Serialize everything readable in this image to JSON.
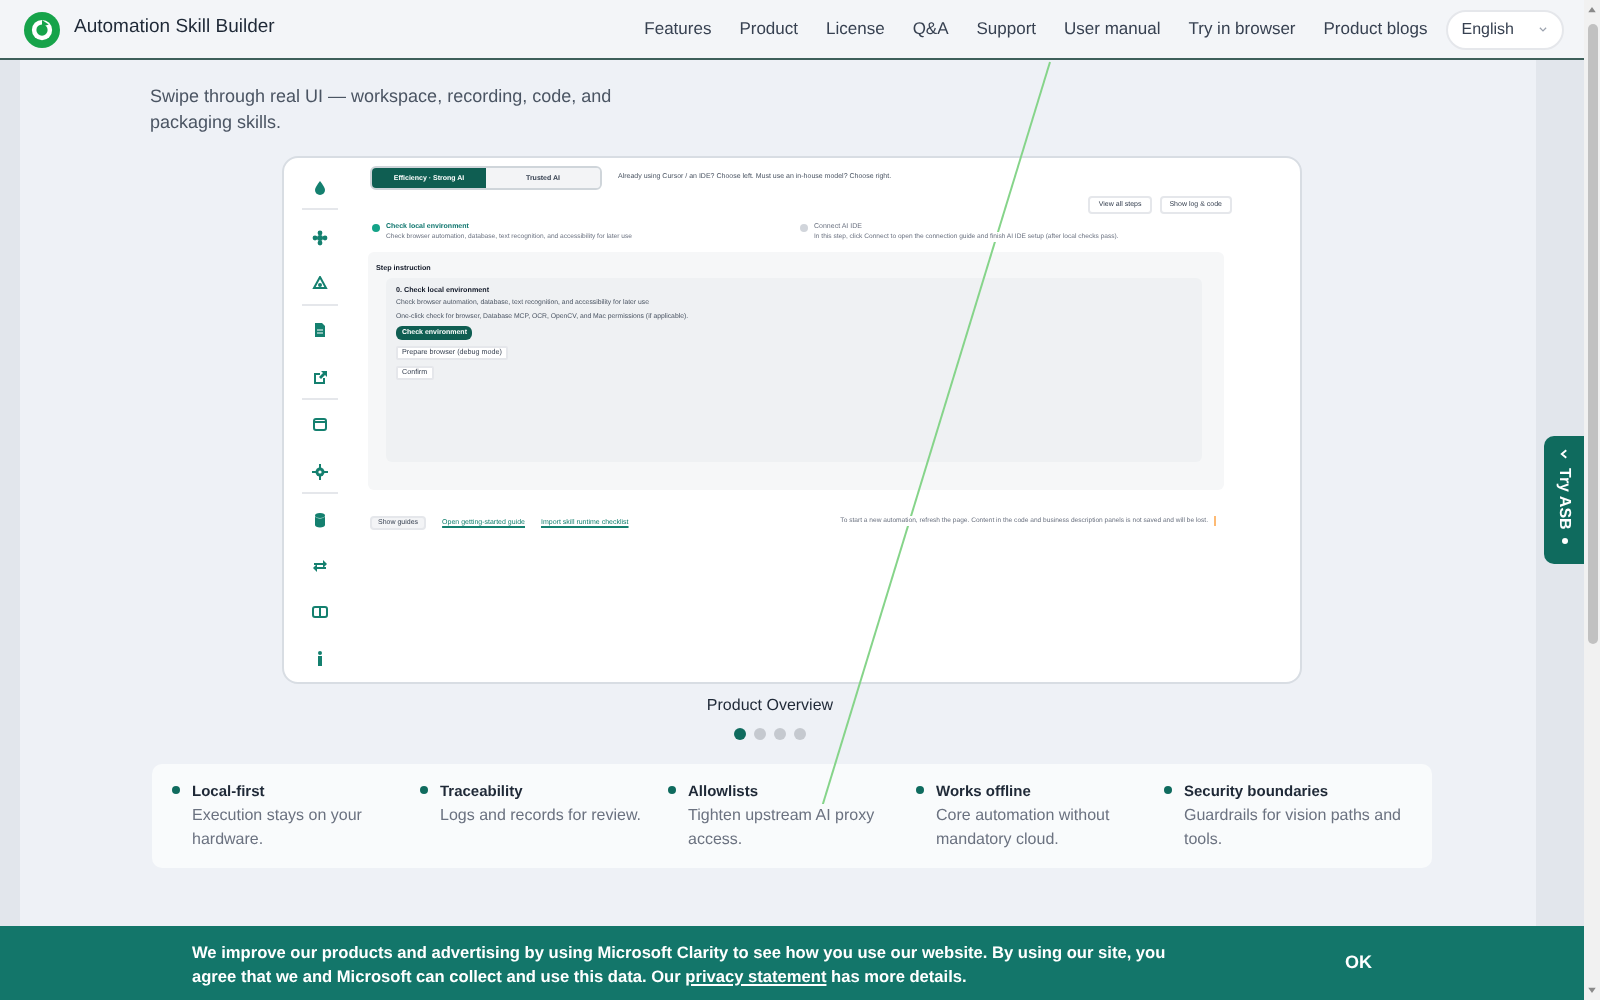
{
  "header": {
    "brand": "Automation Skill Builder",
    "nav": [
      "Features",
      "Product",
      "License",
      "Q&A",
      "Support",
      "User manual",
      "Try in browser",
      "Product blogs"
    ],
    "language": "English"
  },
  "hero": {
    "subtitle": "Swipe through real UI — workspace, recording, code, and packaging skills."
  },
  "preview": {
    "mode_tabs": [
      {
        "label": "Efficiency · Strong AI",
        "selected": true
      },
      {
        "label": "Trusted AI",
        "selected": false
      }
    ],
    "mode_hint": "Already using Cursor / an IDE? Choose left. Must use an in-house model? Choose right.",
    "actions": [
      "View all steps",
      "Show log & code"
    ],
    "steps": [
      {
        "title": "Check local environment",
        "desc": "Check browser automation, database, text recognition, and accessibility for later use",
        "active": true
      },
      {
        "title": "Connect AI IDE",
        "desc": "In this step, click Connect to open the connection guide and finish AI IDE setup (after local checks pass).",
        "active": false
      }
    ],
    "instruction": {
      "heading": "Step instruction",
      "title": "0. Check local environment",
      "lines": [
        "Check browser automation, database, text recognition, and accessibility for later use",
        "One-click check for browser, Database MCP, OCR, OpenCV, and Mac permissions (if applicable)."
      ],
      "primary": "Check environment",
      "secondary": [
        "Prepare browser (debug mode)",
        "Confirm"
      ]
    },
    "footer": {
      "button": "Show guides",
      "links": [
        "Open getting-started guide",
        "Import skill runtime checklist"
      ],
      "note": "To start a new automation, refresh the page. Content in the code and business description panels is not saved and will be lost."
    }
  },
  "carousel": {
    "caption": "Product Overview",
    "dots": [
      {
        "selected": true
      },
      {
        "selected": false
      },
      {
        "selected": false
      },
      {
        "selected": false
      }
    ]
  },
  "features": [
    {
      "title": "Local-first",
      "desc": "Execution stays on your hardware."
    },
    {
      "title": "Traceability",
      "desc": "Logs and records for review."
    },
    {
      "title": "Allowlists",
      "desc": "Tighten upstream AI proxy access."
    },
    {
      "title": "Works offline",
      "desc": "Core automation without mandatory cloud."
    },
    {
      "title": "Security boundaries",
      "desc": "Guardrails for vision paths and tools."
    }
  ],
  "try_tab": {
    "label": "Try ASB"
  },
  "cookie": {
    "text_before": "We improve our products and advertising by using Microsoft Clarity to see how you use our website. By using our site, you agree that we and Microsoft can collect and use this data. Our",
    "link": "privacy statement",
    "text_after": "has more details.",
    "button": "OK"
  }
}
